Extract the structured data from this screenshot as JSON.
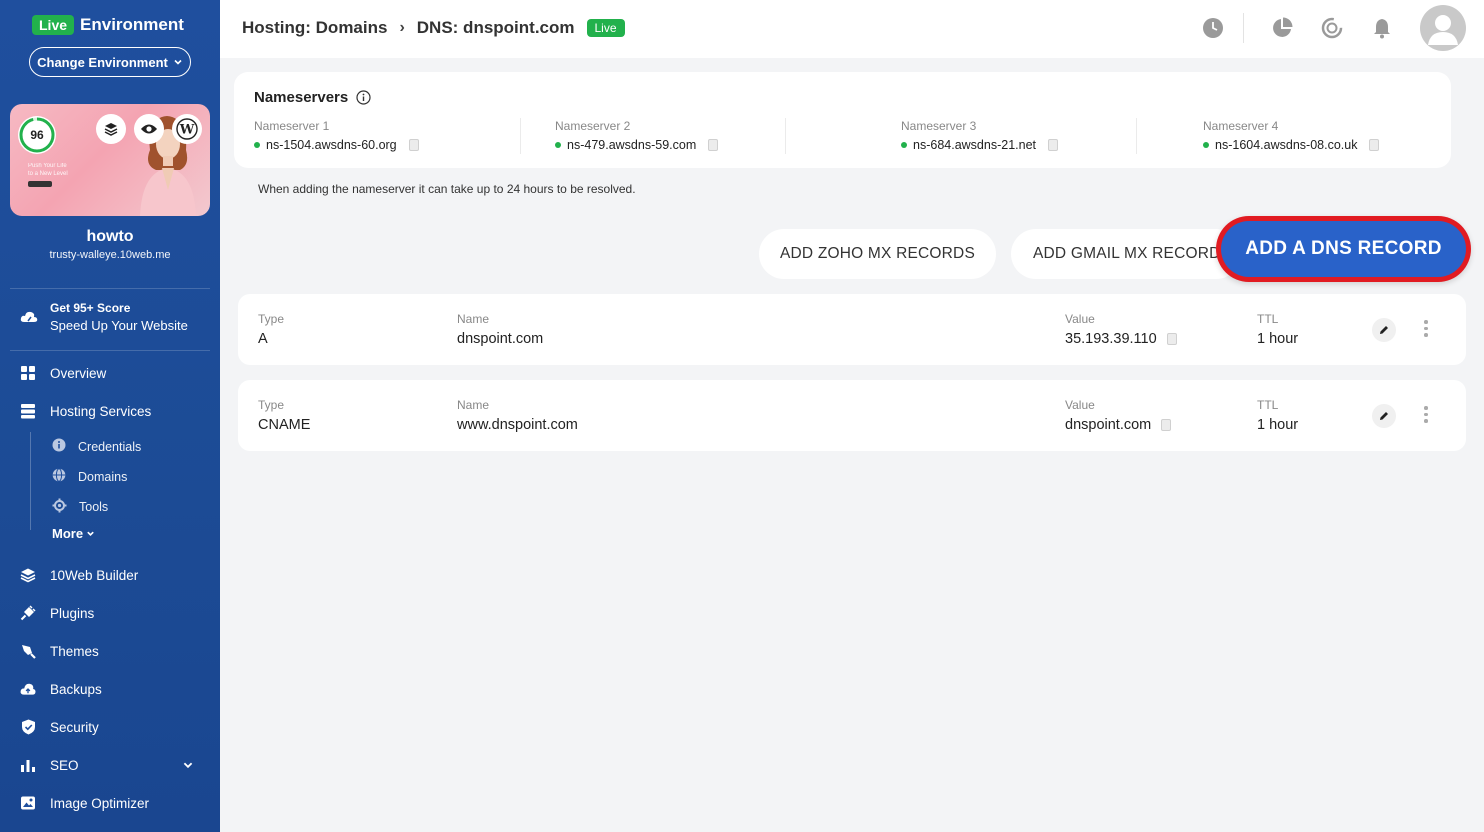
{
  "sidebar": {
    "env_badge": "Live",
    "env_title": "Environment",
    "change_env_label": "Change Environment",
    "score": "96",
    "thumb_text_1": "Push Your Life",
    "thumb_text_2": "to a New Level",
    "site_name": "howto",
    "site_url": "trusty-walleye.10web.me",
    "promo_title": "Get 95+ Score",
    "promo_sub": "Speed Up Your Website",
    "nav": {
      "overview": "Overview",
      "hosting": "Hosting Services",
      "credentials": "Credentials",
      "domains": "Domains",
      "tools": "Tools",
      "more": "More",
      "builder": "10Web Builder",
      "plugins": "Plugins",
      "themes": "Themes",
      "backups": "Backups",
      "security": "Security",
      "seo": "SEO",
      "image_optimizer": "Image Optimizer"
    }
  },
  "header": {
    "crumb_1": "Hosting: Domains",
    "crumb_sep": "›",
    "crumb_2": "DNS: dnspoint.com",
    "live_badge": "Live"
  },
  "nameservers": {
    "title": "Nameservers",
    "items": [
      {
        "label": "Nameserver 1",
        "value": "ns-1504.awsdns-60.org"
      },
      {
        "label": "Nameserver 2",
        "value": "ns-479.awsdns-59.com"
      },
      {
        "label": "Nameserver 3",
        "value": "ns-684.awsdns-21.net"
      },
      {
        "label": "Nameserver 4",
        "value": "ns-1604.awsdns-08.co.uk"
      }
    ],
    "note": "When adding the nameserver it can take up to 24 hours to be resolved."
  },
  "actions": {
    "zoho": "ADD ZOHO MX RECORDS",
    "gmail": "ADD GMAIL MX RECORDS",
    "add_dns": "ADD A DNS RECORD"
  },
  "records": {
    "labels": {
      "type": "Type",
      "name": "Name",
      "value": "Value",
      "ttl": "TTL"
    },
    "rows": [
      {
        "type": "A",
        "name": "dnspoint.com",
        "value": "35.193.39.110",
        "ttl": "1 hour"
      },
      {
        "type": "CNAME",
        "name": "www.dnspoint.com",
        "value": "dnspoint.com",
        "ttl": "1 hour"
      }
    ]
  },
  "colors": {
    "sidebar_blue": "#1f4f9e",
    "live_green": "#22b14c",
    "primary_button": "#2962c9",
    "highlight_outline": "#e11b22"
  }
}
